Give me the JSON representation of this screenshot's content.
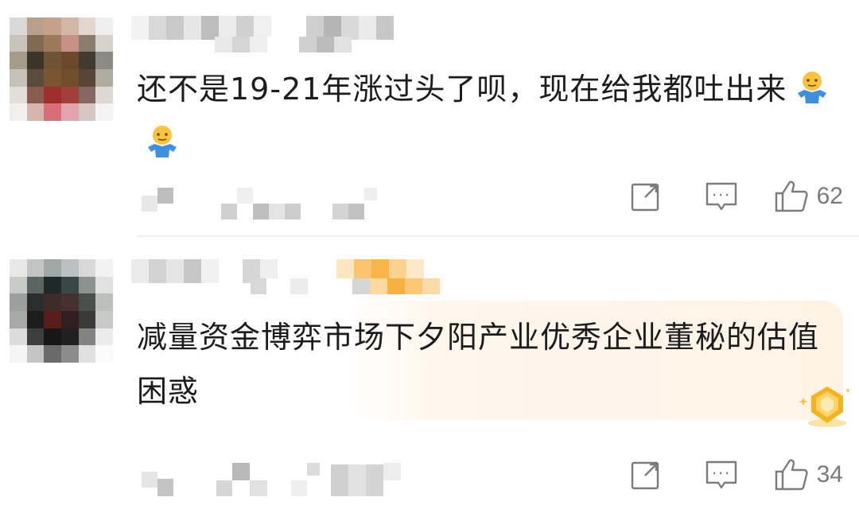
{
  "comments": [
    {
      "text": "还不是19-21年涨过头了呗，现在给我都吐出来",
      "emoji": [
        "person-shrug-emoji",
        "person-shrug-emoji"
      ],
      "like_count": "62"
    },
    {
      "text": "减量资金博弈市场下夕阳产业优秀企业董秘的估值困惑",
      "like_count": "34"
    }
  ],
  "colors": {
    "icon": "#7c7c7c",
    "highlight": "#fff3e6",
    "badge_gold": "#f5b31f"
  }
}
